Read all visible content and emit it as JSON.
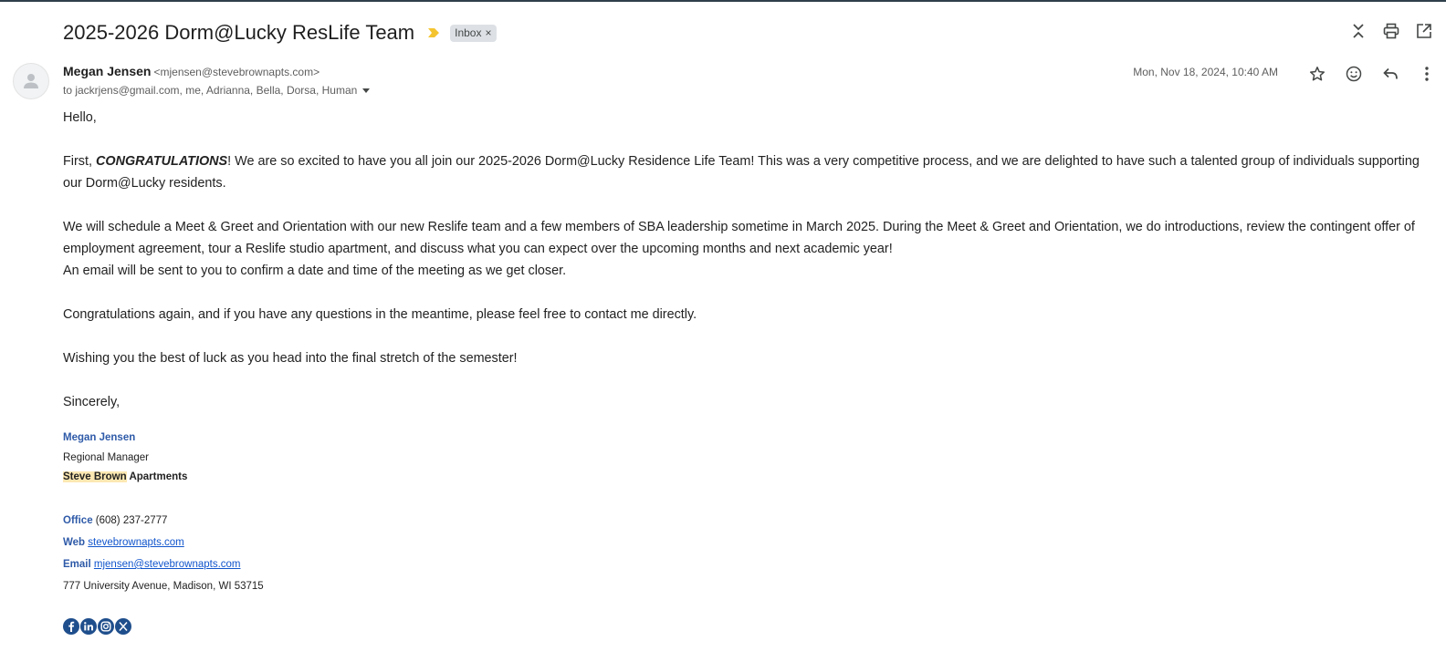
{
  "email": {
    "subject": "2025-2026 Dorm@Lucky ResLife Team",
    "label": "Inbox",
    "label_remove": "×",
    "sender_name": "Megan Jensen",
    "sender_email": "<mjensen@stevebrownapts.com>",
    "to_line": "to jackrjens@gmail.com, me, Adrianna, Bella, Dorsa, Human",
    "date": "Mon, Nov 18, 2024, 10:40 AM"
  },
  "icons": {
    "top": [
      "collapse-all-icon",
      "print-icon",
      "open-in-new-window-icon"
    ],
    "message": [
      "star-icon",
      "emoji-reaction-icon",
      "reply-icon",
      "more-vert-icon"
    ]
  },
  "body": {
    "greeting": "Hello,",
    "p1_first": "First, ",
    "p1_congrats": "CONGRATULATIONS",
    "p1_rest": "!  We are so excited to have you all join our 2025-2026 Dorm@Lucky Residence Life Team! This was a very competitive process, and we are delighted to have such a talented group of individuals supporting our Dorm@Lucky residents.",
    "p2": "We will schedule a Meet & Greet and Orientation with our new Reslife team and a few members of SBA leadership sometime in March 2025. During the Meet & Greet and Orientation, we do introductions, review the contingent offer of employment agreement, tour a Reslife studio apartment, and discuss what you can expect over the upcoming months and next academic year!",
    "p3": "An email will be sent to you to confirm a date and time of the meeting as we get closer.",
    "p4": "Congratulations again, and if you have any questions in the meantime, please feel free to contact me directly.",
    "p5": "Wishing you the best of luck as you head into the final stretch of the semester!",
    "closing": "Sincerely,"
  },
  "signature": {
    "name": "Megan Jensen",
    "title": "Regional Manager",
    "company_highlight": "Steve Brown",
    "company_rest": " Apartments",
    "office_label": "Office",
    "office_value": " (608) 237-2777",
    "web_label": "Web",
    "web_value": "stevebrownapts.com",
    "email_label": "Email",
    "email_value": "mjensen@stevebrownapts.com",
    "address": "777 University Avenue, Madison, WI 53715",
    "social": [
      "facebook-icon",
      "linkedin-icon",
      "instagram-icon",
      "x-twitter-icon"
    ]
  },
  "colors": {
    "accent_blue": "#2e5aa8",
    "link": "#1155cc",
    "importance_marker": "#f4c430",
    "highlight": "#fce8b2"
  }
}
